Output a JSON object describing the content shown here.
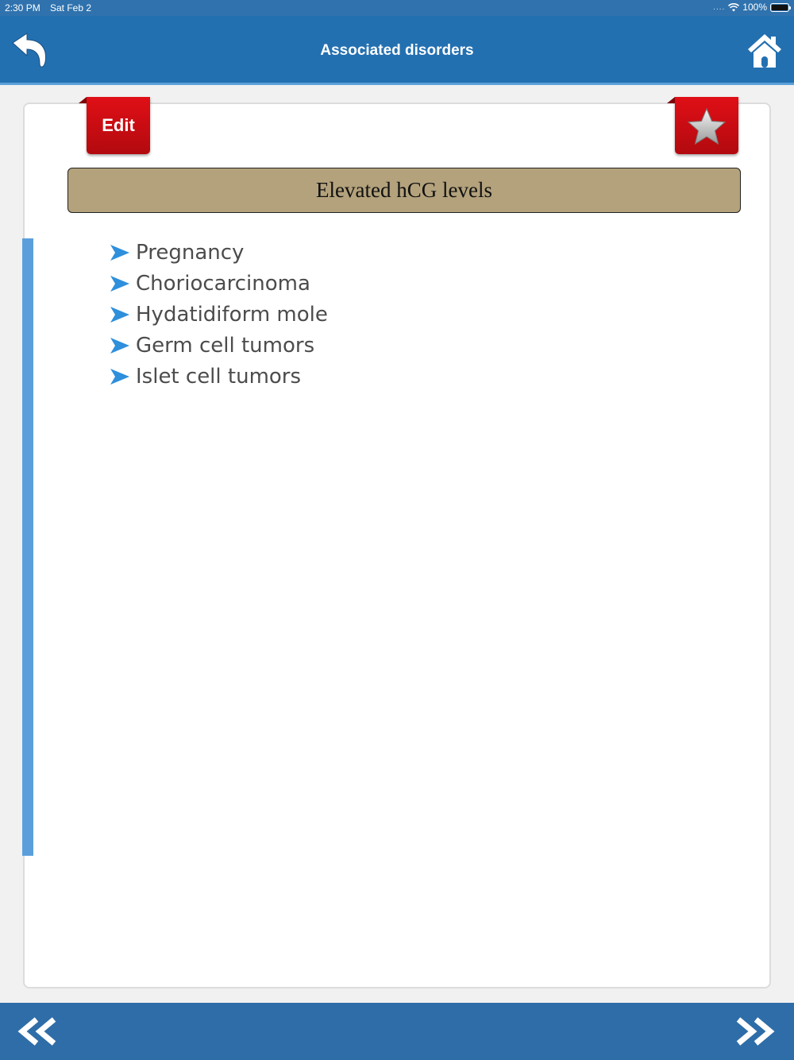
{
  "status_bar": {
    "time": "2:30 PM",
    "date": "Sat Feb 2",
    "signal_dots": "....",
    "battery": "100%"
  },
  "header": {
    "title": "Associated disorders",
    "back_icon": "back-arrow-icon",
    "home_icon": "home-icon"
  },
  "card": {
    "edit_label": "Edit",
    "favorite_icon": "star-icon",
    "heading": "Elevated hCG levels",
    "items": [
      "Pregnancy",
      "Choriocarcinoma",
      "Hydatidiform mole",
      "Germ cell tumors",
      "Islet cell tumors"
    ]
  },
  "footer": {
    "prev_icon": "double-chevron-left-icon",
    "next_icon": "double-chevron-right-icon"
  },
  "colors": {
    "nav_blue": "#2370b1",
    "ribbon_red": "#d10d13",
    "heading_tan": "#b3a27c",
    "accent_blue": "#5a9fdc",
    "bullet_blue": "#2e8fdc"
  }
}
